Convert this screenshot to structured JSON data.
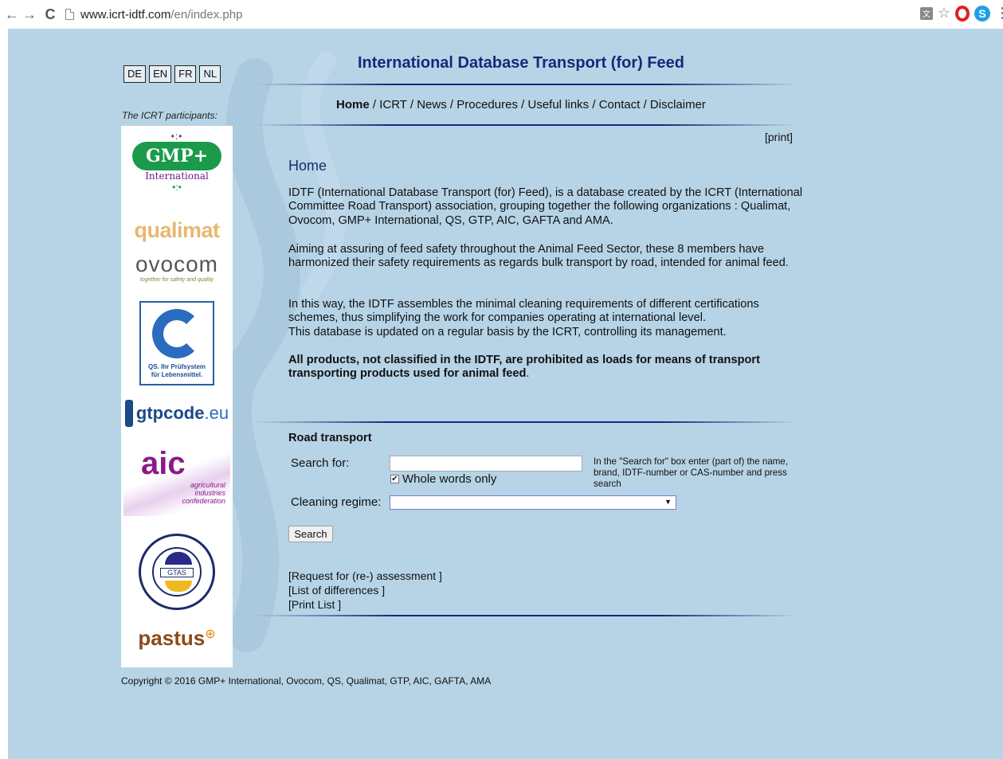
{
  "browser": {
    "url_host": "www.icrt-idtf.com",
    "url_path": "/en/index.php",
    "translate_icon": "translate-icon",
    "star_icon": "bookmark-star-icon",
    "opera_icon": "opera-icon",
    "skype_icon": "skype-icon",
    "skype_letter": "S",
    "menu_icon": "menu-icon"
  },
  "languages": [
    "DE",
    "EN",
    "FR",
    "NL"
  ],
  "site_title": "International Database Transport (for) Feed",
  "nav": {
    "items": [
      "Home",
      "ICRT",
      "News",
      "Procedures",
      "Useful links",
      "Contact",
      "Disclaimer"
    ],
    "active": "Home",
    "separator": " / "
  },
  "print_link": "[print]",
  "participants_label": "The ICRT participants:",
  "logos": {
    "gmp": "GMP+",
    "gmp_sub": "International",
    "qualimat": "qualimat",
    "ovocom": "ovocom",
    "ovocom_tag": "together for safety and quality",
    "qs_line1": "QS. Ihr Prüfsystem",
    "qs_line2": "für Lebensmittel.",
    "gtp_main": "gtpcode",
    "gtp_tld": ".eu",
    "aic": "aic",
    "aic_sub1": "agricultural",
    "aic_sub2": "industries",
    "aic_sub3": "confederation",
    "gtas": "GTAS",
    "pastus": "pastus"
  },
  "main": {
    "heading": "Home",
    "para1": "IDTF (International Database Transport (for) Feed), is a database created by the ICRT (International Committee Road Transport) association, grouping together the following organizations : Qualimat, Ovocom, GMP+ International, QS, GTP, AIC, GAFTA and AMA.",
    "para2": "Aiming at assuring of feed safety throughout  the Animal Feed Sector, these 8 members have harmonized their safety requirements as regards bulk transport by road, intended for animal feed.",
    "para3a": "In this way, the IDTF assembles the minimal cleaning requirements of different certifications schemes, thus simplifying the work for companies operating at international level.",
    "para3b": "This database is updated on a regular basis by the ICRT, controlling its management.",
    "para4": "All products, not classified in the IDTF, are prohibited as loads for means of transport transporting products used for animal feed",
    "para4_end": "."
  },
  "road": {
    "title": "Road transport",
    "search_label": "Search for:",
    "search_value": "",
    "whole_words_label": "Whole words only",
    "whole_words_checked": true,
    "hint": "In the \"Search for\" box enter (part of) the name, brand, IDTF-number or CAS-number and press search",
    "cleaning_label": "Cleaning regime:",
    "cleaning_value": "",
    "search_button": "Search"
  },
  "links": {
    "request": "[Request for (re-) assessment ]",
    "differences": "[List of differences ]",
    "print_list": "[Print List ]"
  },
  "copyright": "Copyright © 2016 GMP+ International, Ovocom, QS, Qualimat, GTP, AIC, GAFTA, AMA"
}
